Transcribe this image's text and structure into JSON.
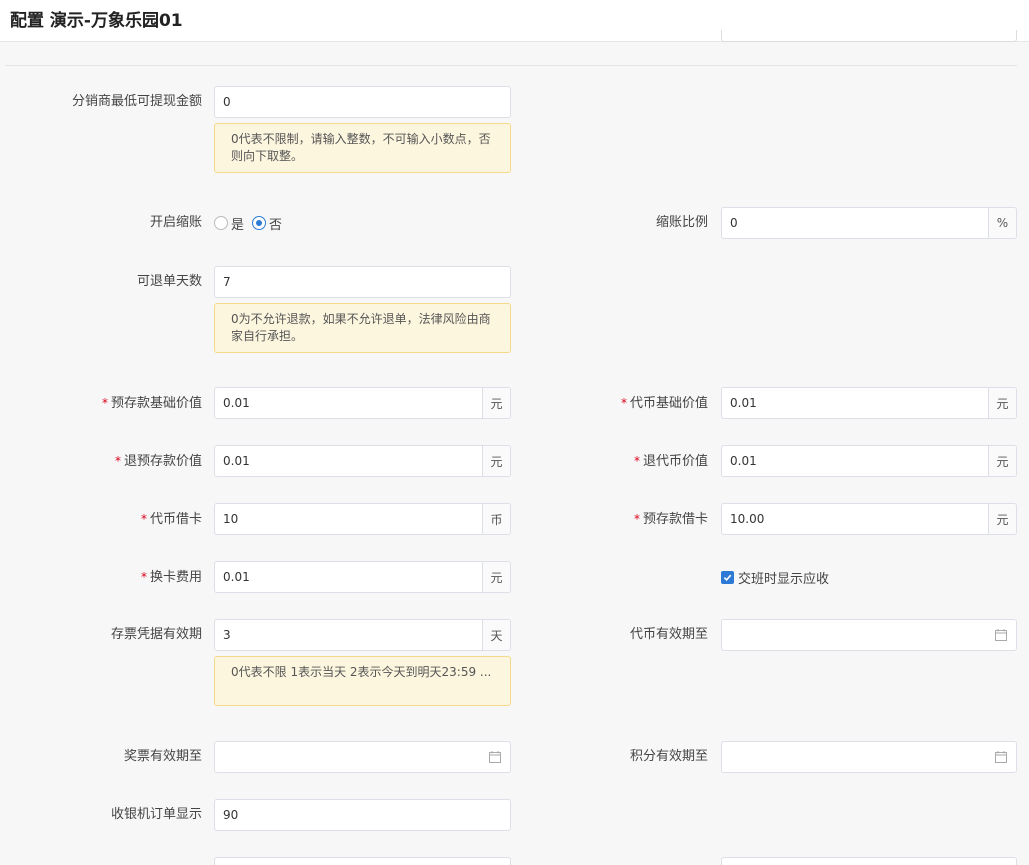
{
  "header": {
    "title": "配置 演示-万象乐园01"
  },
  "form": {
    "min_withdraw": {
      "label": "分销商最低可提现金额",
      "value": "0",
      "hint": "0代表不限制，请输入整数，不可输入小数点，否则向下取整。"
    },
    "enable_shrink": {
      "label": "开启缩账",
      "option_yes": "是",
      "option_no": "否",
      "selected": "否"
    },
    "shrink_ratio": {
      "label": "缩账比例",
      "value": "0",
      "unit": "%"
    },
    "refund_days": {
      "label": "可退单天数",
      "value": "7",
      "hint": "0为不允许退款，如果不允许退单，法律风险由商家自行承担。"
    },
    "deposit_base": {
      "label": "预存款基础价值",
      "value": "0.01",
      "unit": "元",
      "required": "*"
    },
    "token_base": {
      "label": "代币基础价值",
      "value": "0.01",
      "unit": "元",
      "required": "*"
    },
    "refund_deposit": {
      "label": "退预存款价值",
      "value": "0.01",
      "unit": "元",
      "required": "*"
    },
    "refund_token": {
      "label": "退代币价值",
      "value": "0.01",
      "unit": "元",
      "required": "*"
    },
    "token_debit": {
      "label": "代币借卡",
      "value": "10",
      "unit": "币",
      "required": "*"
    },
    "deposit_debit": {
      "label": "预存款借卡",
      "value": "10.00",
      "unit": "元",
      "required": "*"
    },
    "card_change_fee": {
      "label": "换卡费用",
      "value": "0.01",
      "unit": "元",
      "required": "*"
    },
    "shift_show": {
      "label": "交班时显示应收",
      "checked": true
    },
    "ticket_validity": {
      "label": "存票凭据有效期",
      "value": "3",
      "unit": "天",
      "hint": "0代表不限 1表示当天 2表示今天到明天23:59 ..."
    },
    "token_expiry": {
      "label": "代币有效期至",
      "value": ""
    },
    "prize_expiry": {
      "label": "奖票有效期至",
      "value": ""
    },
    "points_expiry": {
      "label": "积分有效期至",
      "value": ""
    },
    "pos_orders": {
      "label": "收银机订单显示",
      "value": "90"
    }
  },
  "colors": {
    "accent": "#2d7ad6",
    "required": "#d9001b",
    "hint_bg": "#fdf6df",
    "hint_border": "#f4d98b"
  }
}
